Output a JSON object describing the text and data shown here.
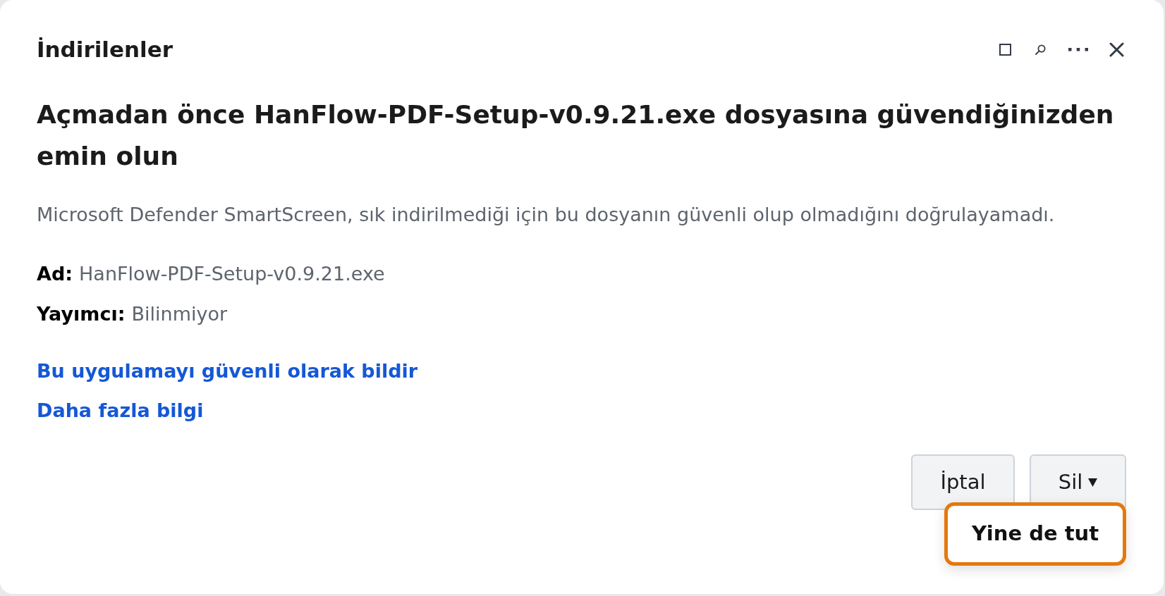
{
  "panel": {
    "title": "İndirilenler"
  },
  "warning": {
    "heading": "Açmadan önce HanFlow-PDF-Setup-v0.9.21.exe dosyasına güvendiğinizden emin olun",
    "description": "Microsoft Defender SmartScreen, sık indirilmediği için bu dosyanın güvenli olup olmadığını doğrulayamadı.",
    "details": [
      {
        "label": "Ad:",
        "value": "HanFlow-PDF-Setup-v0.9.21.exe"
      },
      {
        "label": "Yayımcı:",
        "value": "Bilinmiyor"
      }
    ],
    "links": [
      "Bu uygulamayı güvenli olarak bildir",
      "Daha fazla bilgi"
    ]
  },
  "buttons": [
    {
      "label": "İptal",
      "kind": "plain"
    },
    {
      "label": "Sil",
      "kind": "dropdown",
      "expanded": true,
      "menu": [
        {
          "label": "Yine de tut",
          "focused": true
        }
      ]
    }
  ]
}
